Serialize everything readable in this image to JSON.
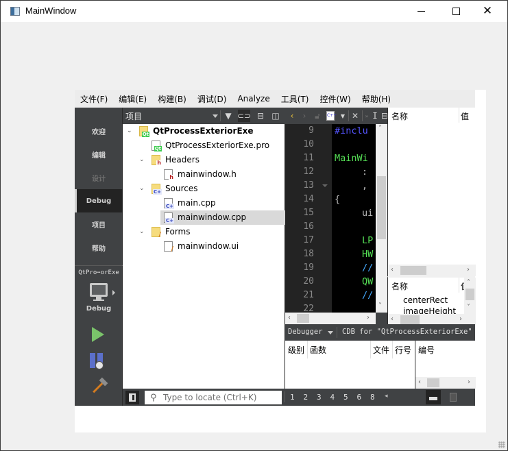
{
  "window": {
    "title": "MainWindow",
    "controls": {
      "minimize": "–",
      "maximize": "□",
      "close": "✕"
    }
  },
  "menubar": {
    "items": [
      "文件(F)",
      "编辑(E)",
      "构建(B)",
      "调试(D)",
      "Analyze",
      "工具(T)",
      "控件(W)",
      "帮助(H)"
    ]
  },
  "modebar": {
    "items": [
      {
        "label": "欢迎",
        "state": "normal"
      },
      {
        "label": "编辑",
        "state": "normal"
      },
      {
        "label": "设计",
        "state": "disabled"
      },
      {
        "label": "Debug",
        "state": "active"
      },
      {
        "label": "项目",
        "state": "normal"
      },
      {
        "label": "帮助",
        "state": "normal"
      }
    ],
    "target": {
      "project": "QtPro⋯orExe",
      "build": "Debug",
      "icon": "monitor-icon"
    },
    "actions": [
      {
        "name": "run",
        "icon": "run-icon"
      },
      {
        "name": "start-debugging",
        "icon": "debug-run-icon"
      },
      {
        "name": "build",
        "icon": "hammer-icon"
      }
    ]
  },
  "project_pane": {
    "title": "项目",
    "toolbar_icons": [
      "filter-icon",
      "link-icon",
      "split-add-icon",
      "close-pane-icon"
    ],
    "tree": [
      {
        "label": "QtProcessExteriorExe",
        "type": "project",
        "level": 0,
        "expanded": true,
        "bold": true
      },
      {
        "label": "QtProcessExteriorExe.pro",
        "type": "pro-file",
        "level": 1
      },
      {
        "label": "Headers",
        "type": "headers-folder",
        "level": 1,
        "expanded": true
      },
      {
        "label": "mainwindow.h",
        "type": "header-file",
        "level": 2
      },
      {
        "label": "Sources",
        "type": "sources-folder",
        "level": 1,
        "expanded": true
      },
      {
        "label": "main.cpp",
        "type": "cpp-file",
        "level": 2
      },
      {
        "label": "mainwindow.cpp",
        "type": "cpp-file",
        "level": 2,
        "selected": true
      },
      {
        "label": "Forms",
        "type": "forms-folder",
        "level": 1,
        "expanded": true
      },
      {
        "label": "mainwindow.ui",
        "type": "ui-file",
        "level": 2
      }
    ]
  },
  "editor": {
    "toolbar_icons": [
      "back-icon",
      "forward-icon",
      "lock-icon",
      "cpp-file-icon",
      "dropdown-icon",
      "close-icon",
      "more-icon",
      "cursor-icon",
      "split-add-icon"
    ],
    "line_numbers": [
      "9",
      "10",
      "11",
      "12",
      "13",
      "14",
      "15",
      "16",
      "17",
      "18",
      "19",
      "20",
      "21",
      "22"
    ],
    "lines": [
      {
        "text": "#inclu",
        "color": "#5555ff",
        "indent": 0
      },
      {
        "text": "",
        "color": "#ffffff",
        "indent": 0
      },
      {
        "text": "MainWi",
        "color": "#55e055",
        "indent": 0
      },
      {
        "text": ":",
        "color": "#bbbbbb",
        "indent": 1
      },
      {
        "text": ",",
        "color": "#bbbbbb",
        "indent": 1
      },
      {
        "text": "{",
        "color": "#bbbbbb",
        "indent": 0
      },
      {
        "text": "ui",
        "color": "#bbbbbb",
        "indent": 1
      },
      {
        "text": "",
        "color": "#ffffff",
        "indent": 0
      },
      {
        "text": "LP",
        "color": "#55e055",
        "indent": 1
      },
      {
        "text": "HW",
        "color": "#55e055",
        "indent": 1
      },
      {
        "text": "//",
        "color": "#44aaff",
        "indent": 1
      },
      {
        "text": "QW",
        "color": "#55e055",
        "indent": 1
      },
      {
        "text": "//",
        "color": "#44aaff",
        "indent": 1
      },
      {
        "text": "",
        "color": "#ffffff",
        "indent": 0
      }
    ]
  },
  "locals": {
    "columns": [
      "名称",
      "值"
    ]
  },
  "watch": {
    "columns": [
      "名称",
      "值"
    ],
    "rows": [
      "centerRect",
      "imageHeight"
    ]
  },
  "debugger_bar": {
    "selector": "Debugger",
    "engine_text": "CDB for \"QtProcessExteriorExe\""
  },
  "stack": {
    "columns": [
      "级别",
      "函数",
      "文件",
      "行号"
    ]
  },
  "threads": {
    "columns": [
      "编号"
    ]
  },
  "statusbar": {
    "locator_placeholder": "Type to locate (Ctrl+K)",
    "output_tabs": [
      "1",
      "2",
      "3",
      "4",
      "5",
      "6",
      "8"
    ]
  }
}
